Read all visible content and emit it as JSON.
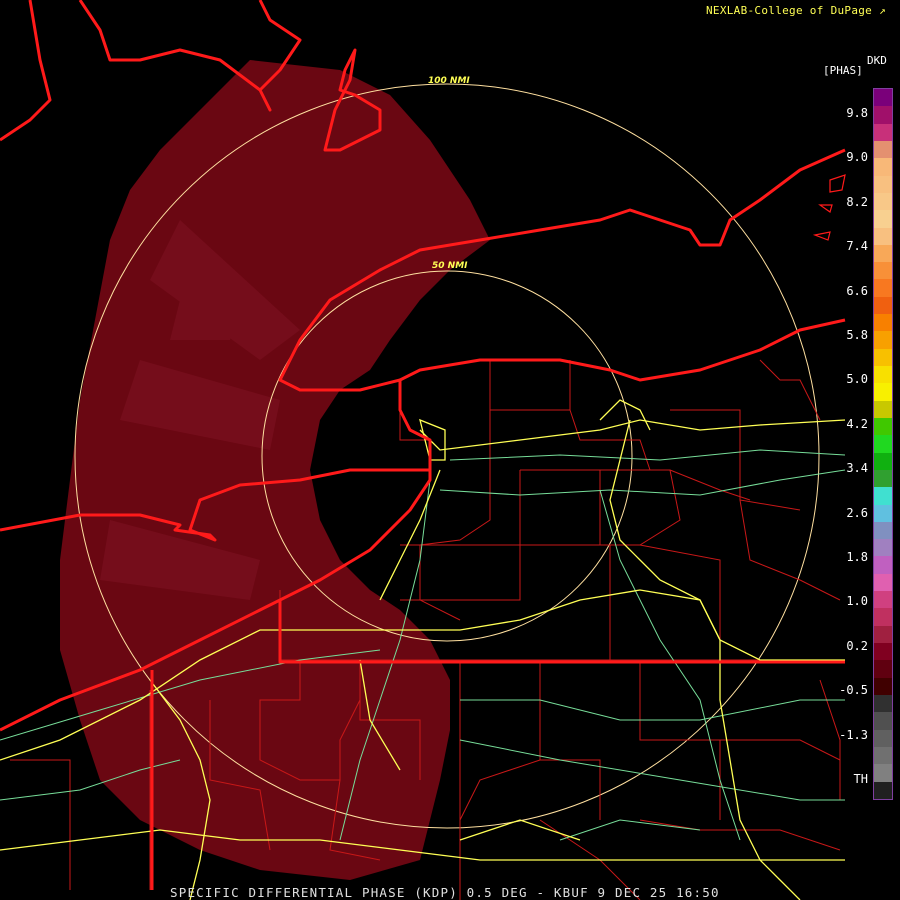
{
  "header": {
    "credit": "NEXLAB-College of DuPage",
    "link_glyph": "↗"
  },
  "product": {
    "code": "DKD",
    "unit": "[PHAS]"
  },
  "range_rings": [
    {
      "label": "100 NMI"
    },
    {
      "label": "50 NMI"
    }
  ],
  "legend": {
    "ticks": [
      "9.8",
      "9.0",
      "8.2",
      "7.4",
      "6.6",
      "5.8",
      "5.0",
      "4.2",
      "3.4",
      "2.6",
      "1.8",
      "1.0",
      "0.2",
      "-0.5",
      "-1.3",
      "TH"
    ],
    "colors": [
      "#7a007a",
      "#a0106a",
      "#c8307a",
      "#e49070",
      "#f8b878",
      "#f8c080",
      "#f8c888",
      "#f8d090",
      "#f8c080",
      "#f8a858",
      "#f89038",
      "#f87820",
      "#f06010",
      "#f88000",
      "#f8a000",
      "#f8c000",
      "#f8e000",
      "#f8f000",
      "#c8c800",
      "#40c800",
      "#20d820",
      "#10b010",
      "#30a030",
      "#40e0d0",
      "#60c0e0",
      "#8090c0",
      "#a080c0",
      "#c060c0",
      "#e060b0",
      "#d04080",
      "#c03060",
      "#a02040",
      "#800020",
      "#600010",
      "#400000",
      "#303030",
      "#505050",
      "#606060",
      "#707070",
      "#808080",
      "#202020"
    ]
  },
  "footer": {
    "text": "SPECIFIC DIFFERENTIAL PHASE (KDP) 0.5 DEG - KBUF 9 DEC 25 16:50"
  },
  "map": {
    "radar_site": "KBUF",
    "colors": {
      "echo": "#6a0712",
      "echo_light": "#7a1020",
      "state_border": "#ff1a1a",
      "county": "#d02020",
      "highway": "#ffff55",
      "road": "#77dd99",
      "ring": "#ffe0a0"
    }
  }
}
